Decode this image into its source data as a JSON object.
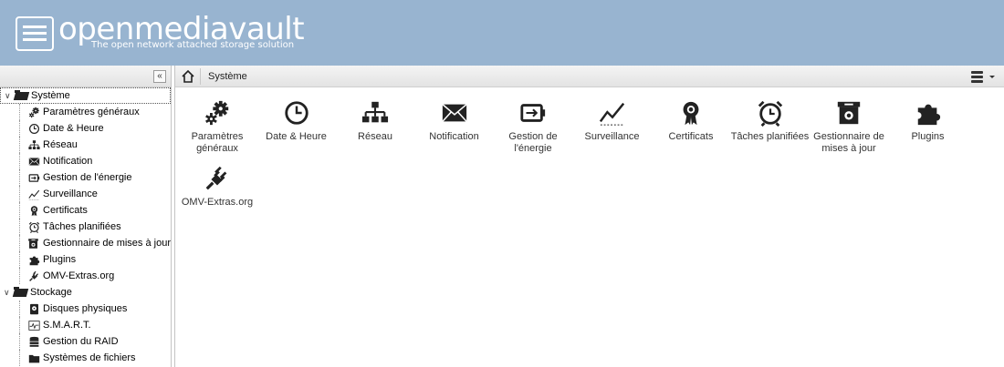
{
  "brand": {
    "name": "openmediavault",
    "tagline": "The open network attached storage solution"
  },
  "colors": {
    "header_bg": "#98b4d0",
    "icon": "#222222"
  },
  "tree": {
    "collapse_label": "«",
    "groups": [
      {
        "label": "Système",
        "expanded": true,
        "selected": true,
        "items": [
          {
            "label": "Paramètres généraux",
            "icon": "gears-icon"
          },
          {
            "label": "Date & Heure",
            "icon": "clock-icon"
          },
          {
            "label": "Réseau",
            "icon": "network-icon"
          },
          {
            "label": "Notification",
            "icon": "envelope-icon"
          },
          {
            "label": "Gestion de l'énergie",
            "icon": "battery-icon"
          },
          {
            "label": "Surveillance",
            "icon": "line-chart-icon"
          },
          {
            "label": "Certificats",
            "icon": "certificate-icon"
          },
          {
            "label": "Tâches planifiées",
            "icon": "alarm-clock-icon"
          },
          {
            "label": "Gestionnaire de mises à jour",
            "icon": "update-box-icon"
          },
          {
            "label": "Plugins",
            "icon": "puzzle-icon"
          },
          {
            "label": "OMV-Extras.org",
            "icon": "plug-icon"
          }
        ]
      },
      {
        "label": "Stockage",
        "expanded": true,
        "selected": false,
        "items": [
          {
            "label": "Disques physiques",
            "icon": "disk-icon"
          },
          {
            "label": "S.M.A.R.T.",
            "icon": "smart-icon"
          },
          {
            "label": "Gestion du RAID",
            "icon": "database-icon"
          },
          {
            "label": "Systèmes de fichiers",
            "icon": "folder-icon"
          }
        ]
      }
    ]
  },
  "breadcrumb": {
    "current": "Système"
  },
  "tiles": [
    {
      "label": "Paramètres généraux",
      "icon": "gears-icon"
    },
    {
      "label": "Date & Heure",
      "icon": "clock-icon"
    },
    {
      "label": "Réseau",
      "icon": "network-icon"
    },
    {
      "label": "Notification",
      "icon": "envelope-icon"
    },
    {
      "label": "Gestion de l'énergie",
      "icon": "battery-icon"
    },
    {
      "label": "Surveillance",
      "icon": "line-chart-icon"
    },
    {
      "label": "Certificats",
      "icon": "certificate-icon"
    },
    {
      "label": "Tâches planifiées",
      "icon": "alarm-clock-icon"
    },
    {
      "label": "Gestionnaire de mises à jour",
      "icon": "update-box-icon"
    },
    {
      "label": "Plugins",
      "icon": "puzzle-icon"
    },
    {
      "label": "OMV-Extras.org",
      "icon": "plug-icon"
    }
  ]
}
